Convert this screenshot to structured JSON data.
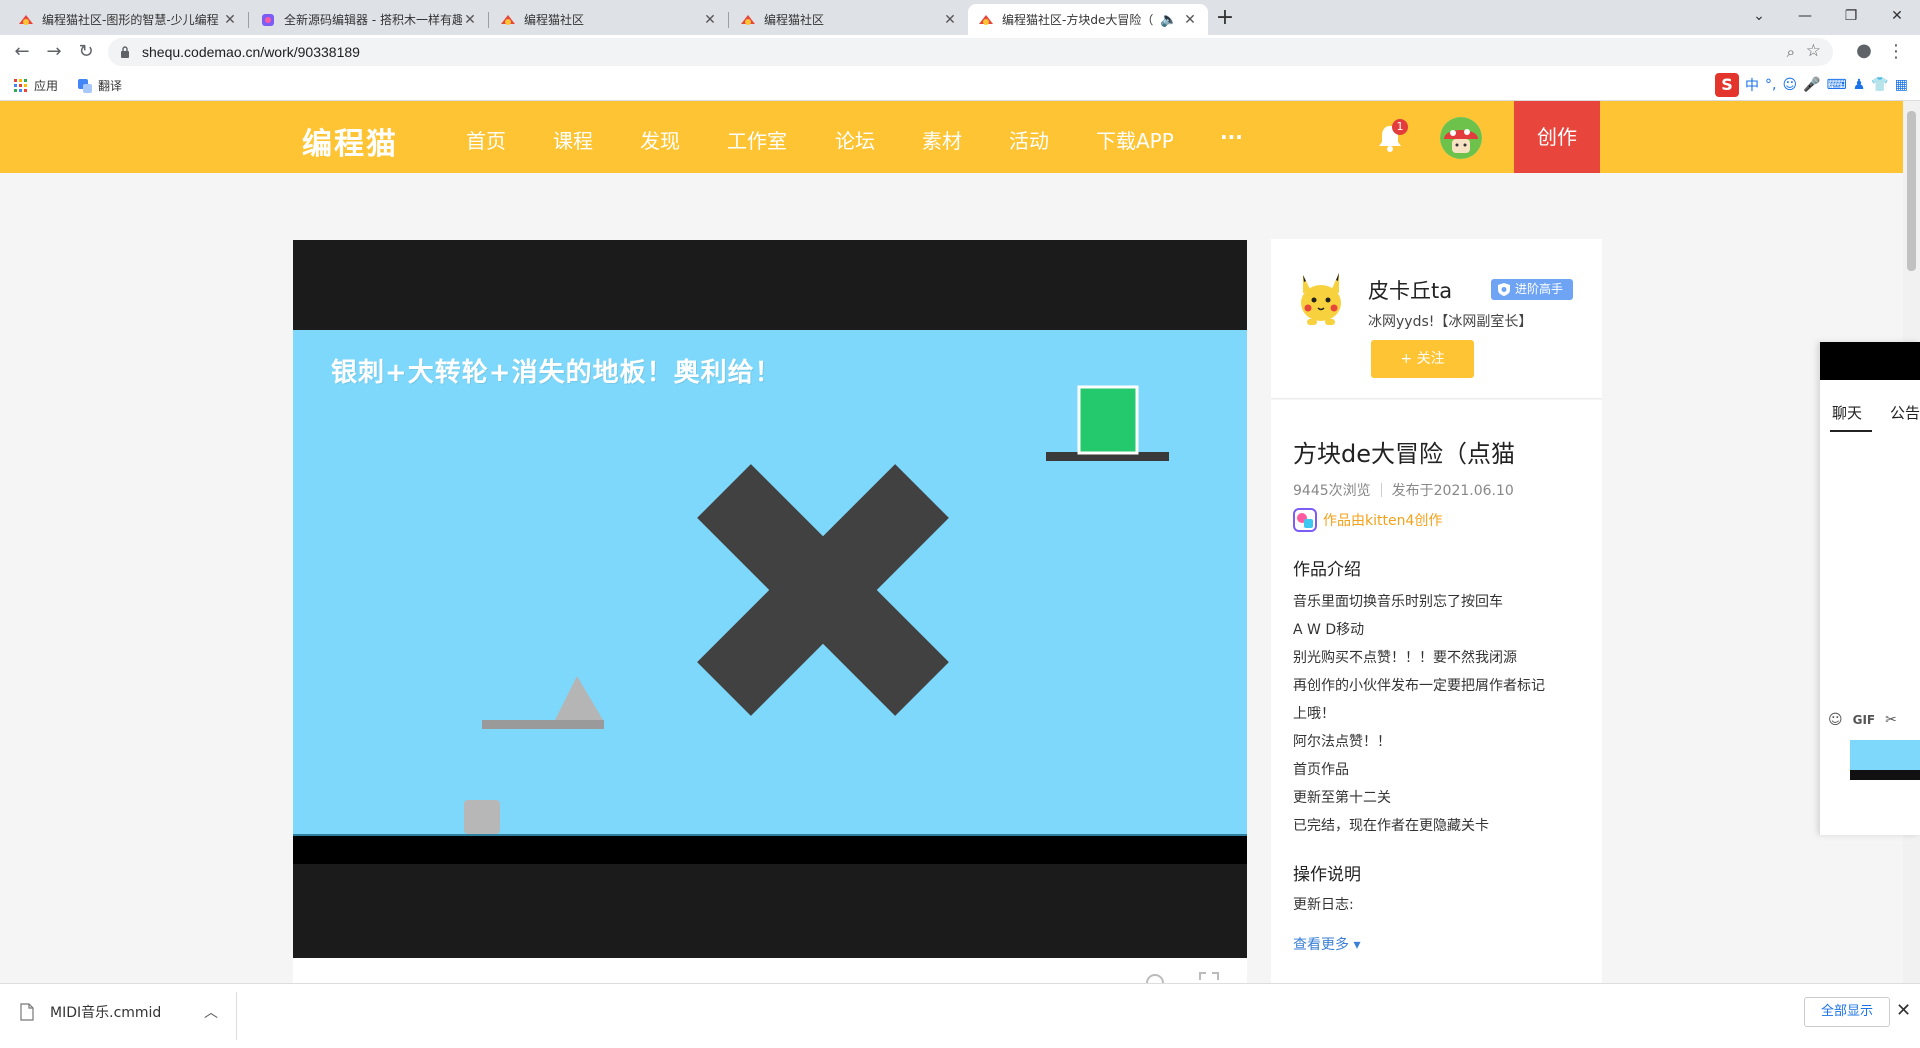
{
  "browser": {
    "tabs": [
      {
        "title": "编程猫社区-图形的智慧-少儿编程",
        "active": false
      },
      {
        "title": "全新源码编辑器 - 搭积木一样有趣",
        "active": false
      },
      {
        "title": "编程猫社区",
        "active": false
      },
      {
        "title": "编程猫社区",
        "active": false
      },
      {
        "title": "编程猫社区-方块de大冒险（",
        "active": true
      }
    ],
    "new_tab": "+",
    "url": "shequ.codemao.cn/work/90338189",
    "bookmarks": [
      {
        "label": "应用",
        "icon": "apps-grid-icon"
      },
      {
        "label": "翻译",
        "icon": "translate-icon"
      }
    ],
    "ime_label": "中"
  },
  "site": {
    "logo": "编程猫",
    "nav": [
      "首页",
      "课程",
      "发现",
      "工作室",
      "论坛",
      "素材",
      "活动",
      "下载APP"
    ],
    "more": "···",
    "notifications_count": "1",
    "create_label": "创作",
    "brand_color": "#fec433",
    "create_color": "#e8453c"
  },
  "player": {
    "stage_title": "银刺+大转轮+消失的地板！奥利给！",
    "stage_bg": "#7ed8fb"
  },
  "author": {
    "name": "皮卡丘ta",
    "badge": "进阶高手",
    "signature": "冰网yyds!【冰网副室长】",
    "follow_label": "+ 关注"
  },
  "work": {
    "title": "方块de大冒险（点猫",
    "views": "9445次浏览",
    "published": "发布于2021.06.10",
    "made_with": "作品由kitten4创作",
    "intro_heading": "作品介绍",
    "intro_lines": [
      "音乐里面切换音乐时别忘了按回车",
      "A  W  D移动",
      "别光购买不点赞！！！要不然我闭源",
      "再创作的小伙伴发布一定要把屑作者标记",
      "上哦！",
      "阿尔法点赞！！",
      "首页作品",
      "更新至第十二关",
      "已完结，现在作者在更隐藏关卡"
    ],
    "ops_heading": "操作说明",
    "update_log": "更新日志:",
    "see_more": "查看更多 ▾"
  },
  "chat": {
    "tabs": [
      "聊天",
      "公告"
    ],
    "gif": "GIF"
  },
  "download": {
    "file": "MIDI音乐.cmmid",
    "show_all": "全部显示",
    "close": "✕"
  }
}
